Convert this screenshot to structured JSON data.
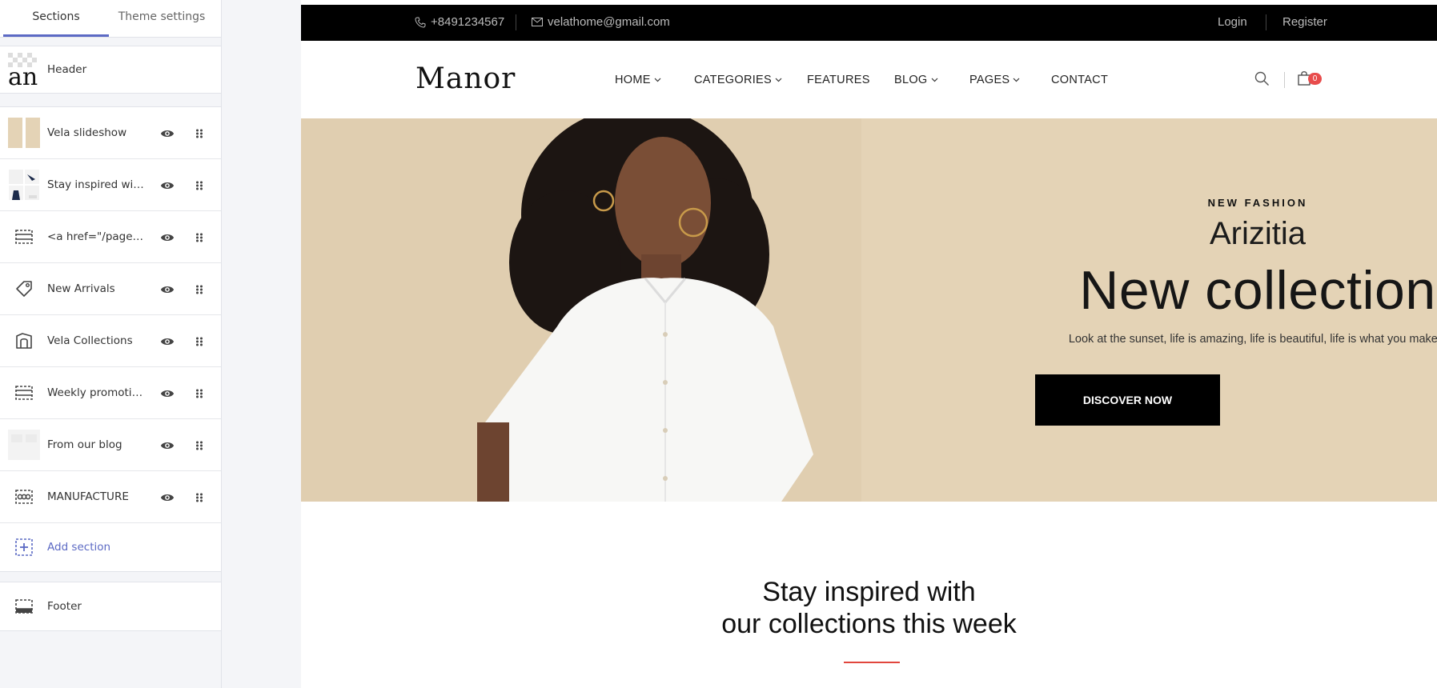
{
  "tabs": {
    "sections": "Sections",
    "theme_settings": "Theme settings"
  },
  "header_row": {
    "label": "Header"
  },
  "sections": [
    {
      "label": "Vela slideshow",
      "icon": "slideshow-thumb"
    },
    {
      "label": "Stay inspired with ...",
      "icon": "collection-thumb"
    },
    {
      "label": "<a href=\"/pages/l...",
      "icon": "banner-icon"
    },
    {
      "label": "New Arrivals",
      "icon": "tag-icon"
    },
    {
      "label": "Vela Collections",
      "icon": "collection-icon"
    },
    {
      "label": "Weekly promotions",
      "icon": "banner-icon"
    },
    {
      "label": "From our blog",
      "icon": "blog-thumb"
    },
    {
      "label": "MANUFACTURE",
      "icon": "logo-list-icon"
    }
  ],
  "add_section": {
    "label": "Add section"
  },
  "footer_row": {
    "label": "Footer"
  },
  "store": {
    "phone": "+8491234567",
    "email": "velathome@gmail.com",
    "login": "Login",
    "register": "Register",
    "logo": "Manor",
    "nav": [
      "HOME",
      "CATEGORIES",
      "FEATURES",
      "BLOG",
      "PAGES",
      "CONTACT"
    ],
    "cart_count": "0",
    "hero": {
      "eyebrow": "NEW FASHION",
      "subtitle": "Arizitia",
      "title": "New collection",
      "description": "Look at the sunset, life is amazing, life is beautiful, life is what you make it",
      "button": "DISCOVER NOW"
    },
    "section_title_line1": "Stay inspired with",
    "section_title_line2": "our collections this week"
  },
  "colors": {
    "accent": "#5c6ac4",
    "hero_bg": "#e4d3b6",
    "badge": "#e84c4c",
    "divider_red": "#e1463d"
  }
}
